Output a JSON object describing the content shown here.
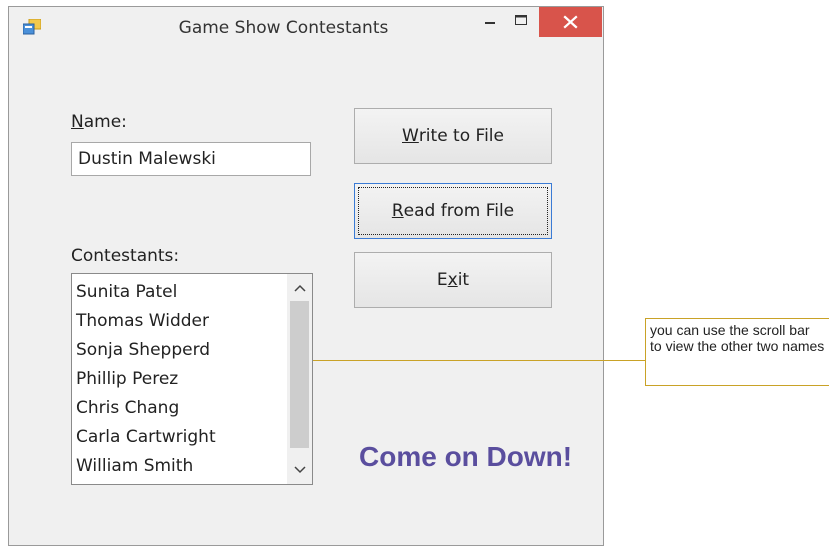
{
  "window": {
    "title": "Game Show Contestants",
    "accent_close": "#d8544b"
  },
  "form": {
    "name_label_mnemonic": "N",
    "name_label_rest": "ame:",
    "name_value": "Dustin Malewski",
    "contestants_label": "Contestants:",
    "contestants": [
      "Sunita Patel",
      "Thomas Widder",
      "Sonja Shepperd",
      "Phillip Perez",
      "Chris Chang",
      "Carla Cartwright",
      "William Smith"
    ],
    "buttons": {
      "write_mnemonic": "W",
      "write_rest": "rite to File",
      "read_mnemonic": "R",
      "read_rest": "ead from File",
      "exit_pre": "E",
      "exit_mnemonic": "x",
      "exit_post": "it"
    },
    "slogan": "Come on Down!",
    "slogan_color": "#5a4e9e"
  },
  "callout": {
    "text": "you can use the scroll bar to view the other two names",
    "border_color": "#c9a227"
  }
}
